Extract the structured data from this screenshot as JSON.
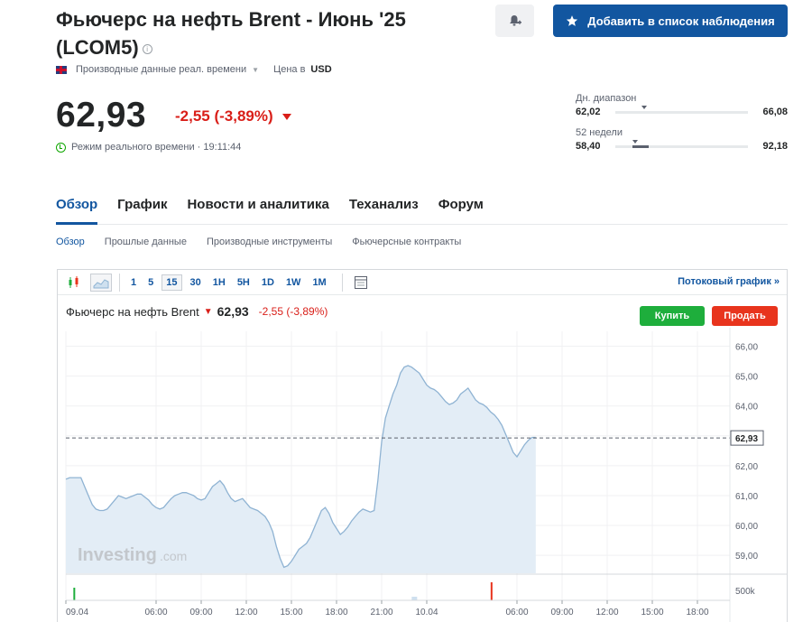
{
  "header": {
    "title": "Фьючерс на нефть Brent - Июнь '25 (LCOM5)",
    "info_glyph": "i",
    "watchlist_button": "Добавить в список наблюдения"
  },
  "meta": {
    "data_type": "Производные данные реал. времени",
    "currency_label": "Цена в",
    "currency": "USD"
  },
  "quote": {
    "price": "62,93",
    "change": "-2,55 (-3,89%)",
    "realtime_label": "Режим реального времени · 19:11:44"
  },
  "ranges": {
    "day": {
      "label": "Дн. диапазон",
      "low": "62,02",
      "high": "66,08",
      "current_fraction": 0.2
    },
    "week52": {
      "label": "52 недели",
      "low": "58,40",
      "high": "92,18",
      "current_fraction": 0.13
    }
  },
  "tabs": [
    {
      "label": "Обзор",
      "active": true
    },
    {
      "label": "График",
      "active": false
    },
    {
      "label": "Новости и аналитика",
      "active": false
    },
    {
      "label": "Теханализ",
      "active": false
    },
    {
      "label": "Форум",
      "active": false
    }
  ],
  "subtabs": [
    {
      "label": "Обзор",
      "active": true
    },
    {
      "label": "Прошлые данные",
      "active": false
    },
    {
      "label": "Производные инструменты",
      "active": false
    },
    {
      "label": "Фьючерсные контракты",
      "active": false
    }
  ],
  "toolbar": {
    "timeframes": [
      "1",
      "5",
      "15",
      "30",
      "1H",
      "5H",
      "1D",
      "1W",
      "1M"
    ],
    "active_timeframe": "15",
    "stream_label": "Потоковый график »"
  },
  "chart_header": {
    "name": "Фьючерс на нефть Brent",
    "price": "62,93",
    "change": "-2,55 (-3,89%)",
    "buy_label": "Купить",
    "sell_label": "Продать",
    "watermark": "Investing",
    "watermark_suffix": ".com",
    "volume_label": "500k"
  },
  "colors": {
    "accent": "#1256a0",
    "down": "#d91e18",
    "buy": "#1eae3c",
    "sell": "#e8341d",
    "line": "#8fb3d3",
    "area": "#e3edf6"
  },
  "chart_data": {
    "type": "area",
    "y_ticks": [
      "66,00",
      "65,00",
      "64,00",
      "63,00",
      "62,00",
      "61,00",
      "60,00",
      "59,00"
    ],
    "y_tick_values": [
      66,
      65,
      64,
      63,
      62,
      61,
      60,
      59
    ],
    "current_price_label": "62,93",
    "current_price": 62.93,
    "ylim": [
      58.4,
      66.5
    ],
    "x_ticks": [
      "09.04",
      "06:00",
      "09:00",
      "12:00",
      "15:00",
      "18:00",
      "21:00",
      "10.04",
      "06:00",
      "09:00",
      "12:00",
      "15:00",
      "18:00"
    ],
    "x_tick_index": [
      0,
      24,
      36,
      48,
      60,
      72,
      84,
      96,
      120,
      132,
      144,
      156,
      168
    ],
    "series": [
      {
        "values": [
          61.55,
          61.6,
          61.6,
          61.6,
          61.6,
          61.3,
          61.0,
          60.7,
          60.55,
          60.5,
          60.5,
          60.55,
          60.7,
          60.85,
          61.0,
          60.95,
          60.9,
          60.95,
          61.0,
          61.05,
          61.05,
          60.95,
          60.85,
          60.7,
          60.6,
          60.55,
          60.6,
          60.75,
          60.9,
          61.0,
          61.05,
          61.1,
          61.1,
          61.05,
          61.0,
          60.9,
          60.85,
          60.9,
          61.1,
          61.3,
          61.4,
          61.5,
          61.35,
          61.1,
          60.9,
          60.8,
          60.85,
          60.9,
          60.75,
          60.6,
          60.55,
          60.5,
          60.4,
          60.3,
          60.1,
          59.8,
          59.3,
          58.9,
          58.6,
          58.65,
          58.8,
          59.0,
          59.2,
          59.3,
          59.4,
          59.6,
          59.9,
          60.2,
          60.5,
          60.6,
          60.4,
          60.1,
          59.9,
          59.7,
          59.8,
          59.95,
          60.15,
          60.3,
          60.45,
          60.55,
          60.5,
          60.45,
          60.5,
          61.5,
          62.8,
          63.6,
          64.0,
          64.4,
          64.7,
          65.1,
          65.3,
          65.35,
          65.3,
          65.2,
          65.1,
          64.9,
          64.7,
          64.6,
          64.55,
          64.45,
          64.3,
          64.15,
          64.05,
          64.1,
          64.2,
          64.4,
          64.5,
          64.6,
          64.4,
          64.2,
          64.1,
          64.05,
          63.95,
          63.8,
          63.7,
          63.55,
          63.35,
          63.05,
          62.75,
          62.45,
          62.3,
          62.5,
          62.7,
          62.85,
          62.95,
          62.95
        ],
        "note_removed": true
      }
    ]
  }
}
